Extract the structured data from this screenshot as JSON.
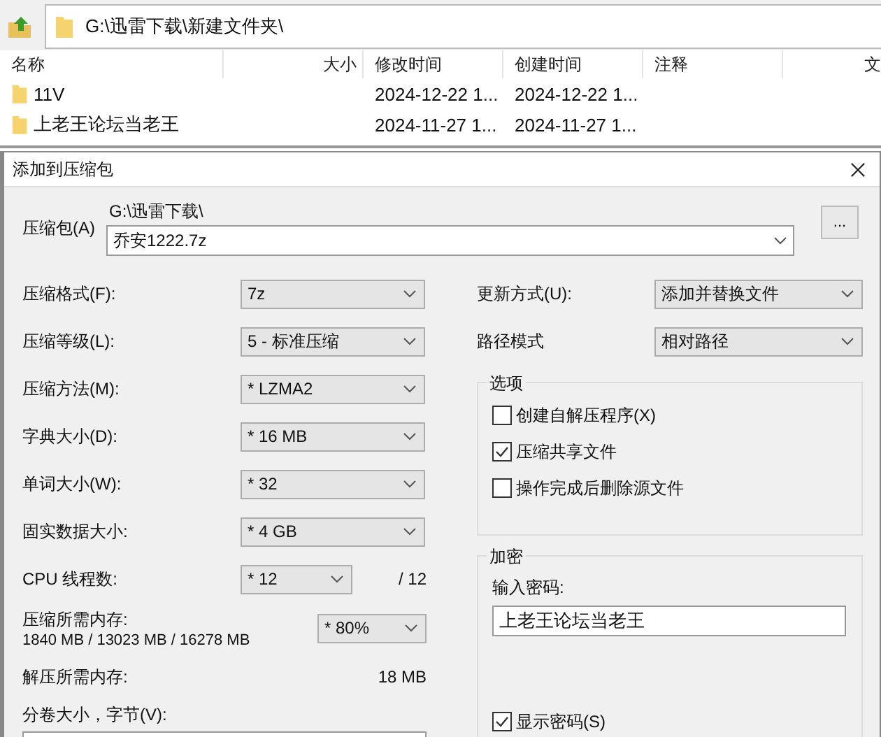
{
  "explorer": {
    "address": "G:\\迅雷下载\\新建文件夹\\",
    "columns": [
      "名称",
      "大小",
      "修改时间",
      "创建时间",
      "注释",
      "文"
    ],
    "rows": [
      {
        "name": "11V",
        "modified": "2024-12-22 1...",
        "created": "2024-12-22 1..."
      },
      {
        "name": "上老王论坛当老王",
        "modified": "2024-11-27 1...",
        "created": "2024-11-27 1..."
      }
    ]
  },
  "dialog": {
    "title": "添加到压缩包",
    "archive": {
      "label": "压缩包(A)",
      "folder": "G:\\迅雷下载\\",
      "value": "乔安1222.7z",
      "browse": "..."
    },
    "left_fields": [
      {
        "label": "压缩格式(F):",
        "value": "7z"
      },
      {
        "label": "压缩等级(L):",
        "value": "5 - 标准压缩"
      },
      {
        "label": "压缩方法(M):",
        "value": "* LZMA2"
      },
      {
        "label": "字典大小(D):",
        "value": "* 16 MB"
      },
      {
        "label": "单词大小(W):",
        "value": "* 32"
      },
      {
        "label": "固实数据大小:",
        "value": "* 4 GB"
      }
    ],
    "threads": {
      "label": "CPU 线程数:",
      "value": "* 12",
      "max": "/ 12"
    },
    "memory": {
      "label": "压缩所需内存:",
      "detail": "1840 MB / 13023 MB / 16278 MB",
      "value": "* 80%"
    },
    "decompress_memory": {
      "label": "解压所需内存:",
      "value": "18 MB"
    },
    "volume": {
      "label": "分卷大小，字节(V):"
    },
    "right_fields": [
      {
        "label": "更新方式(U):",
        "value": "添加并替换文件"
      },
      {
        "label": "路径模式",
        "value": "相对路径"
      }
    ],
    "options": {
      "title": "选项",
      "items": [
        {
          "label": "创建自解压程序(X)",
          "checked": false
        },
        {
          "label": "压缩共享文件",
          "checked": true
        },
        {
          "label": "操作完成后删除源文件",
          "checked": false
        }
      ]
    },
    "encryption": {
      "title": "加密",
      "password_label": "输入密码:",
      "password": "上老王论坛当老王",
      "show_password": {
        "label": "显示密码(S)",
        "checked": true
      }
    }
  }
}
